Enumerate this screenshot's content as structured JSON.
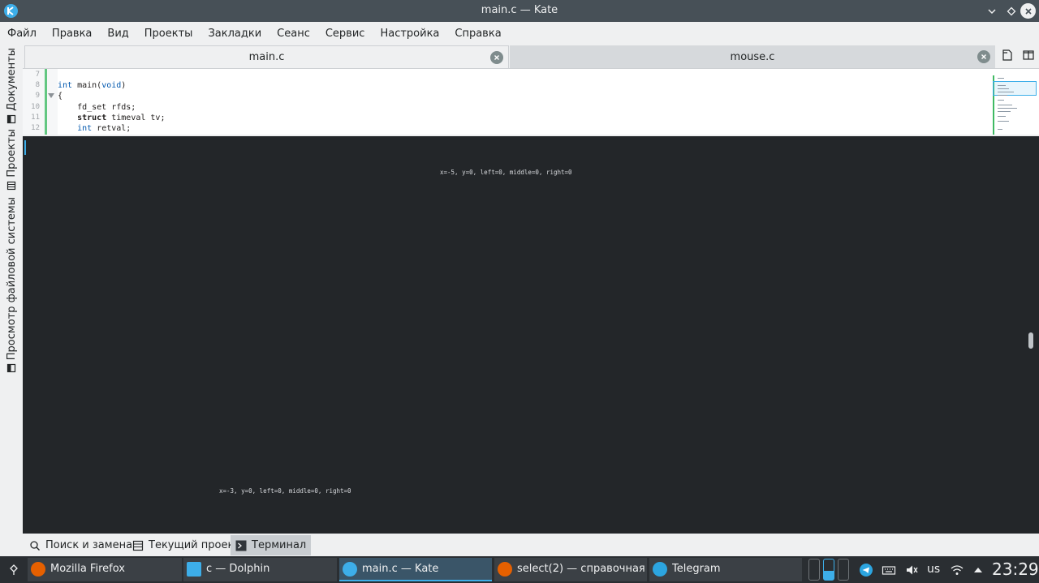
{
  "window": {
    "title": "main.c — Kate"
  },
  "menu": [
    "Файл",
    "Правка",
    "Вид",
    "Проекты",
    "Закладки",
    "Сеанс",
    "Сервис",
    "Настройка",
    "Справка"
  ],
  "sidebar": {
    "items": [
      {
        "label": "Документы",
        "icon": "document-icon"
      },
      {
        "label": "Проекты",
        "icon": "projects-icon"
      },
      {
        "label": "Просмотр файловой системы",
        "icon": "filesystem-icon"
      }
    ]
  },
  "tabs": [
    {
      "label": "main.c",
      "active": true
    },
    {
      "label": "mouse.c",
      "active": false
    }
  ],
  "editor": {
    "line_numbers": [
      "7",
      "8",
      "9",
      "10",
      "11",
      "12"
    ],
    "lines": [
      "",
      "int main(void)",
      "{",
      "    fd_set rfds;",
      "    struct timeval tv;",
      "    int retval;"
    ]
  },
  "terminal": {
    "line1": "x=-5, y=0, left=0, middle=0, right=0",
    "line2": "x=-3, y=0, left=0, middle=0, right=0"
  },
  "bottom_tabs": [
    {
      "label": "Поиск и замена",
      "icon": "search-icon",
      "active": false
    },
    {
      "label": "Текущий проект",
      "icon": "project-list-icon",
      "active": false
    },
    {
      "label": "Терминал",
      "icon": "terminal-icon",
      "active": true
    }
  ],
  "taskbar": {
    "tasks": [
      {
        "label": "Mozilla Firefox",
        "icon": "firefox-icon",
        "color": "#e66000"
      },
      {
        "label": "c — Dolphin",
        "icon": "folder-icon",
        "color": "#3daee9"
      },
      {
        "label": "main.c  — Kate",
        "icon": "kate-icon",
        "color": "#3daee9"
      },
      {
        "label": "select(2) — справочная с...",
        "icon": "firefox-icon",
        "color": "#e66000"
      },
      {
        "label": "Telegram",
        "icon": "telegram-icon",
        "color": "#2ca5e0"
      }
    ],
    "keyboard_layout": "us",
    "clock": "23:29"
  },
  "colors": {
    "accent": "#3daee9",
    "titlebar": "#475057",
    "terminal_bg": "#232629",
    "taskbar_bg": "#2a2e32"
  }
}
